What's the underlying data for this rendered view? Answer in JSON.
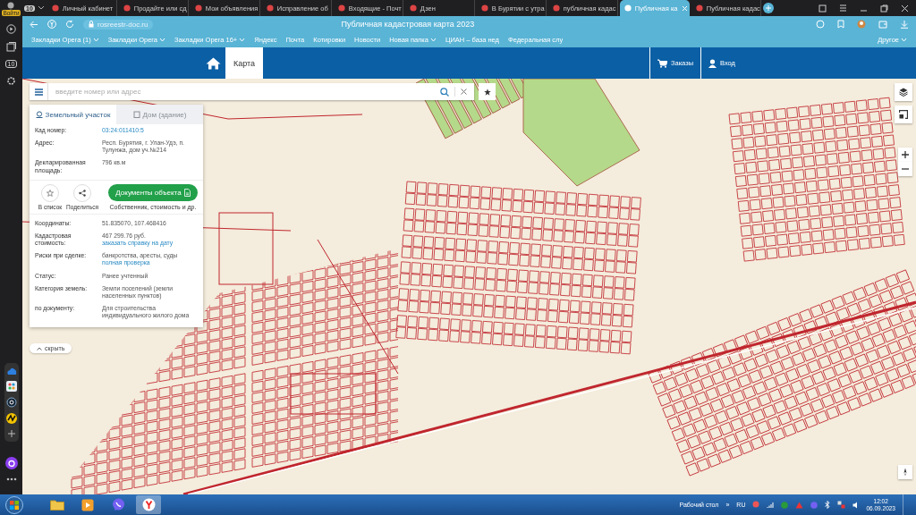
{
  "opera_sidebar": {
    "profile_label": "Войти",
    "workspace": "10"
  },
  "browser": {
    "workspace_badge": "10",
    "tabs": [
      {
        "title": "Личный кабинет",
        "selected": false
      },
      {
        "title": "Продайте или сд",
        "selected": false
      },
      {
        "title": "Мои объявления",
        "selected": false
      },
      {
        "title": "Исправление об",
        "selected": false
      },
      {
        "title": "Входящие - Почт",
        "selected": false
      },
      {
        "title": "Дзен",
        "selected": false
      },
      {
        "title": "В Бурятии с утра",
        "selected": false
      },
      {
        "title": "публичная кадас",
        "selected": false
      },
      {
        "title": "Публичная ка",
        "selected": true
      },
      {
        "title": "Публичная кадас",
        "selected": false
      }
    ],
    "url": "rosreestr-doc.ru",
    "page_title": "Публичная кадастровая карта 2023",
    "bookmarks": [
      {
        "label": "Закладки Opera (1)",
        "kind": "folder"
      },
      {
        "label": "Закладки Opera",
        "kind": "folder"
      },
      {
        "label": "Закладки Opera 16+",
        "kind": "folder"
      },
      {
        "label": "Яндекс",
        "kind": "link"
      },
      {
        "label": "Почта",
        "kind": "link"
      },
      {
        "label": "Котировки",
        "kind": "link"
      },
      {
        "label": "Новости",
        "kind": "link"
      },
      {
        "label": "Новая папка",
        "kind": "folder"
      },
      {
        "label": "ЦИАН – база нед",
        "kind": "link"
      },
      {
        "label": "Федеральная слу",
        "kind": "link"
      }
    ],
    "other_bookmarks": "Другое"
  },
  "site_header": {
    "nav": [
      {
        "label": "Карта",
        "selected": true
      }
    ],
    "orders": "Заказы",
    "login": "Вход"
  },
  "search": {
    "placeholder": "введите номер или адрес"
  },
  "panel": {
    "tabs": [
      {
        "label": "Земельный участок",
        "selected": true
      },
      {
        "label": "Дом (здание)",
        "selected": false
      }
    ],
    "fields": [
      {
        "label": "Кад номер:",
        "lines": [
          {
            "text": "03:24:011410:5",
            "kind": "link"
          }
        ]
      },
      {
        "label": "Адрес:",
        "lines": [
          {
            "text": "Респ. Бурятия, г. Улан-Удэ, п. Тулунжа, дом уч.№214",
            "kind": "text"
          }
        ]
      },
      {
        "label": "Декларированная площадь:",
        "lines": [
          {
            "text": "796 кв.м",
            "kind": "text"
          }
        ]
      }
    ],
    "actions": [
      {
        "label": "В список"
      },
      {
        "label": "Поделиться"
      }
    ],
    "documents_button": "Документы объекта",
    "documents_caption": "Собственник, стоимость и др.",
    "details": [
      {
        "label": "Координаты:",
        "lines": [
          {
            "text": "51.835070, 107.468416",
            "kind": "text"
          }
        ]
      },
      {
        "label": "Кадастровая стоимость:",
        "lines": [
          {
            "text": "467 299.76 руб.",
            "kind": "text"
          },
          {
            "text": "заказать справку на дату",
            "kind": "link"
          }
        ]
      },
      {
        "label": "Риски при сделке:",
        "lines": [
          {
            "text": "банкротства, аресты, суды",
            "kind": "text"
          },
          {
            "text": "полная проверка",
            "kind": "link"
          }
        ]
      },
      {
        "label": "Статус:",
        "lines": [
          {
            "text": "Ранее учтенный",
            "kind": "text"
          }
        ]
      },
      {
        "label": "Категория земель:",
        "lines": [
          {
            "text": "Земли поселений (земли населенных пунктов)",
            "kind": "text"
          }
        ]
      },
      {
        "label": "по документу:",
        "lines": [
          {
            "text": "Для строительства индивидуального жилого дома",
            "kind": "text"
          }
        ]
      }
    ]
  },
  "hide_button": "скрыть",
  "taskbar": {
    "desktop_label": "Рабочий стол",
    "more": "»",
    "language": "RU",
    "time": "12:02",
    "date": "06.09.2023"
  }
}
